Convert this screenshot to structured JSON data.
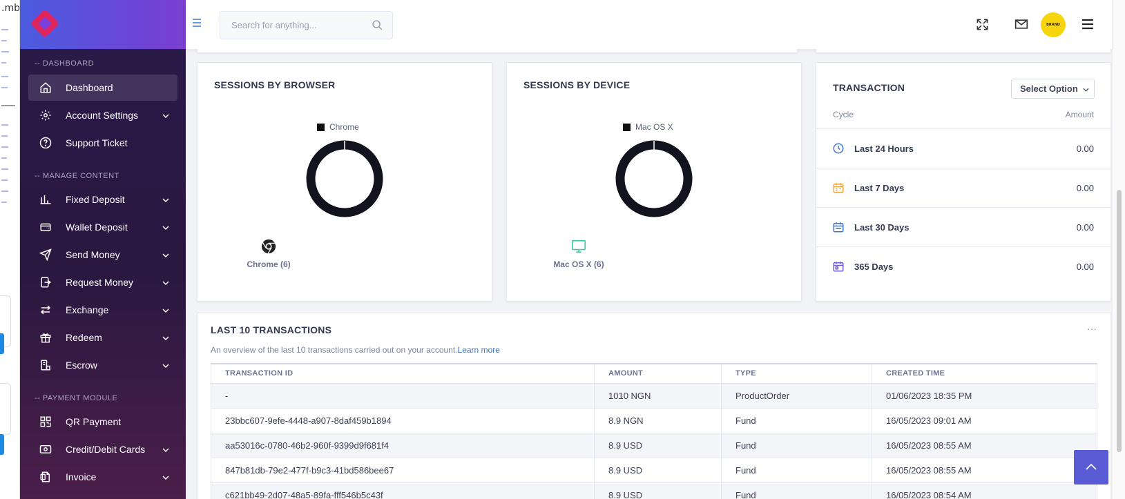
{
  "background_app": {
    "fragment_text": ".mb"
  },
  "sidebar": {
    "sections": [
      {
        "title": "-- DASHBOARD"
      },
      {
        "title": "-- MANAGE CONTENT"
      },
      {
        "title": "-- PAYMENT MODULE"
      }
    ],
    "items": [
      {
        "label": "Dashboard",
        "icon": "home-icon"
      },
      {
        "label": "Account Settings",
        "icon": "gear-icon"
      },
      {
        "label": "Support Ticket",
        "icon": "help-circle-icon"
      },
      {
        "label": "Fixed Deposit",
        "icon": "bar-chart-icon"
      },
      {
        "label": "Wallet Deposit",
        "icon": "wallet-icon"
      },
      {
        "label": "Send Money",
        "icon": "send-icon"
      },
      {
        "label": "Request Money",
        "icon": "request-money-icon"
      },
      {
        "label": "Exchange",
        "icon": "exchange-icon"
      },
      {
        "label": "Redeem",
        "icon": "gift-icon"
      },
      {
        "label": "Escrow",
        "icon": "escrow-icon"
      },
      {
        "label": "QR Payment",
        "icon": "qr-code-icon"
      },
      {
        "label": "Credit/Debit Cards",
        "icon": "credit-card-icon"
      },
      {
        "label": "Invoice",
        "icon": "invoice-icon"
      }
    ]
  },
  "topbar": {
    "search_placeholder": "Search for anything...",
    "avatar_text": "BRAND"
  },
  "sessions_by_browser": {
    "title": "SESSIONS BY BROWSER",
    "legend": "Chrome",
    "stat_label": "Chrome (6)"
  },
  "sessions_by_device": {
    "title": "SESSIONS BY DEVICE",
    "legend": "Mac OS X",
    "stat_label": "Mac OS X (6)"
  },
  "chart_data": [
    {
      "type": "pie",
      "categories": [
        "Chrome"
      ],
      "values": [
        6
      ],
      "title": "SESSIONS BY BROWSER",
      "legend": "top"
    },
    {
      "type": "pie",
      "categories": [
        "Mac OS X"
      ],
      "values": [
        6
      ],
      "title": "SESSIONS BY DEVICE",
      "legend": "top"
    }
  ],
  "transaction": {
    "title": "TRANSACTION",
    "select_label": "Select Option",
    "col_cycle": "Cycle",
    "col_amount": "Amount",
    "rows": [
      {
        "label": "Last 24 Hours",
        "amount": "0.00",
        "color": "#3a76d0"
      },
      {
        "label": "Last 7 Days",
        "amount": "0.00",
        "color": "#f0a43a"
      },
      {
        "label": "Last 30 Days",
        "amount": "0.00",
        "color": "#3a76d0"
      },
      {
        "label": "365 Days",
        "amount": "0.00",
        "color": "#6b5bd6"
      }
    ]
  },
  "last_transactions": {
    "title": "LAST 10 TRANSACTIONS",
    "subtitle": "An overview of the last 10 transactions carried out on your account.",
    "learn_more": "Learn more",
    "columns": [
      "TRANSACTION ID",
      "AMOUNT",
      "TYPE",
      "CREATED TIME"
    ],
    "rows": [
      [
        "-",
        "1010 NGN",
        "ProductOrder",
        "01/06/2023 18:35 PM"
      ],
      [
        "23bbc607-9efe-4448-a907-8daf459b1894",
        "8.9 NGN",
        "Fund",
        "16/05/2023 09:01 AM"
      ],
      [
        "aa53016c-0780-46b2-960f-9399d9f681f4",
        "8.9 USD",
        "Fund",
        "16/05/2023 08:55 AM"
      ],
      [
        "847b81db-79e2-477f-b9c3-41bd586bee67",
        "8.9 USD",
        "Fund",
        "16/05/2023 08:55 AM"
      ],
      [
        "c621bb49-2d07-48a5-89fa-fff546b5c43f",
        "8.9 USD",
        "Fund",
        "16/05/2023 08:54 AM"
      ]
    ]
  },
  "colors": {
    "accent": "#5a5cd6",
    "sidebar_bg": "#2a1a4a",
    "donut": "#12131f"
  }
}
